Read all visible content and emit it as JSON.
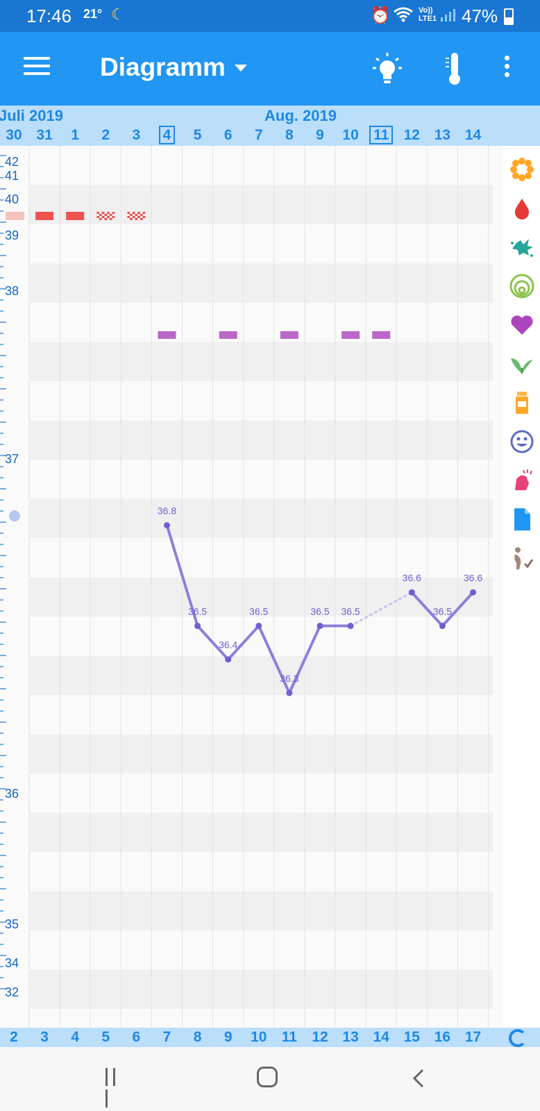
{
  "status_bar": {
    "time": "17:46",
    "temp": "21°",
    "lte_line1": "Vo))",
    "lte_line2": "LTE1",
    "battery": "47%"
  },
  "app_bar": {
    "title": "Diagramm",
    "icons": [
      "menu-icon",
      "dropdown-icon",
      "lightbulb-icon",
      "thermometer-icon",
      "overflow-menu-icon"
    ]
  },
  "date_header": {
    "months": [
      "Juli 2019",
      "Aug. 2019"
    ],
    "days": [
      "30",
      "31",
      "1",
      "2",
      "3",
      "4",
      "5",
      "6",
      "7",
      "8",
      "9",
      "10",
      "11",
      "12",
      "13",
      "14"
    ],
    "highlighted_days": [
      "4",
      "11"
    ]
  },
  "y_axis": {
    "labels": [
      "42",
      "41",
      "40",
      "39",
      "38",
      "37",
      "36",
      "35",
      "34",
      "32"
    ]
  },
  "cycle_days": [
    "2",
    "3",
    "4",
    "5",
    "6",
    "7",
    "8",
    "9",
    "10",
    "11",
    "12",
    "13",
    "14",
    "15",
    "16",
    "17"
  ],
  "chart_data": {
    "type": "line",
    "x": [
      "30",
      "31",
      "1",
      "2",
      "3",
      "4",
      "5",
      "6",
      "7",
      "8",
      "9",
      "10",
      "11",
      "12",
      "13",
      "14"
    ],
    "series": [
      {
        "values": [
          null,
          null,
          null,
          null,
          null,
          36.8,
          36.5,
          36.4,
          36.5,
          36.3,
          36.5,
          36.5,
          null,
          36.6,
          36.5,
          36.6
        ]
      }
    ],
    "labels": [
      "36.8",
      "36.5",
      "36.4",
      "36.5",
      "36.3",
      "36.5",
      "36.5",
      "36.6",
      "36.5",
      "36.6"
    ],
    "dotted_segment": [
      "10",
      "12"
    ],
    "period_days": [
      "30",
      "31",
      "1",
      "2",
      "3"
    ],
    "period_pattern": [
      "faint",
      "heavy",
      "heavy",
      "spotting",
      "spotting"
    ],
    "intercourse_days": [
      "4",
      "6",
      "8",
      "10",
      "11"
    ],
    "colors": {
      "line": "#8b80dc",
      "period": "#ef5350",
      "intercourse": "#ba68c8",
      "accent": "#2196f3",
      "header": "#bbdefb"
    }
  },
  "side_icons": [
    "flower-icon",
    "blood-drop-icon",
    "splash-icon",
    "cervix-icon",
    "heart-icon",
    "leaf-icon",
    "pill-bottle-icon",
    "smiley-icon",
    "symptom-icon",
    "note-icon",
    "pregnancy-test-icon"
  ],
  "nav_bar": {
    "icons": [
      "recents-icon",
      "home-icon",
      "back-icon"
    ]
  }
}
